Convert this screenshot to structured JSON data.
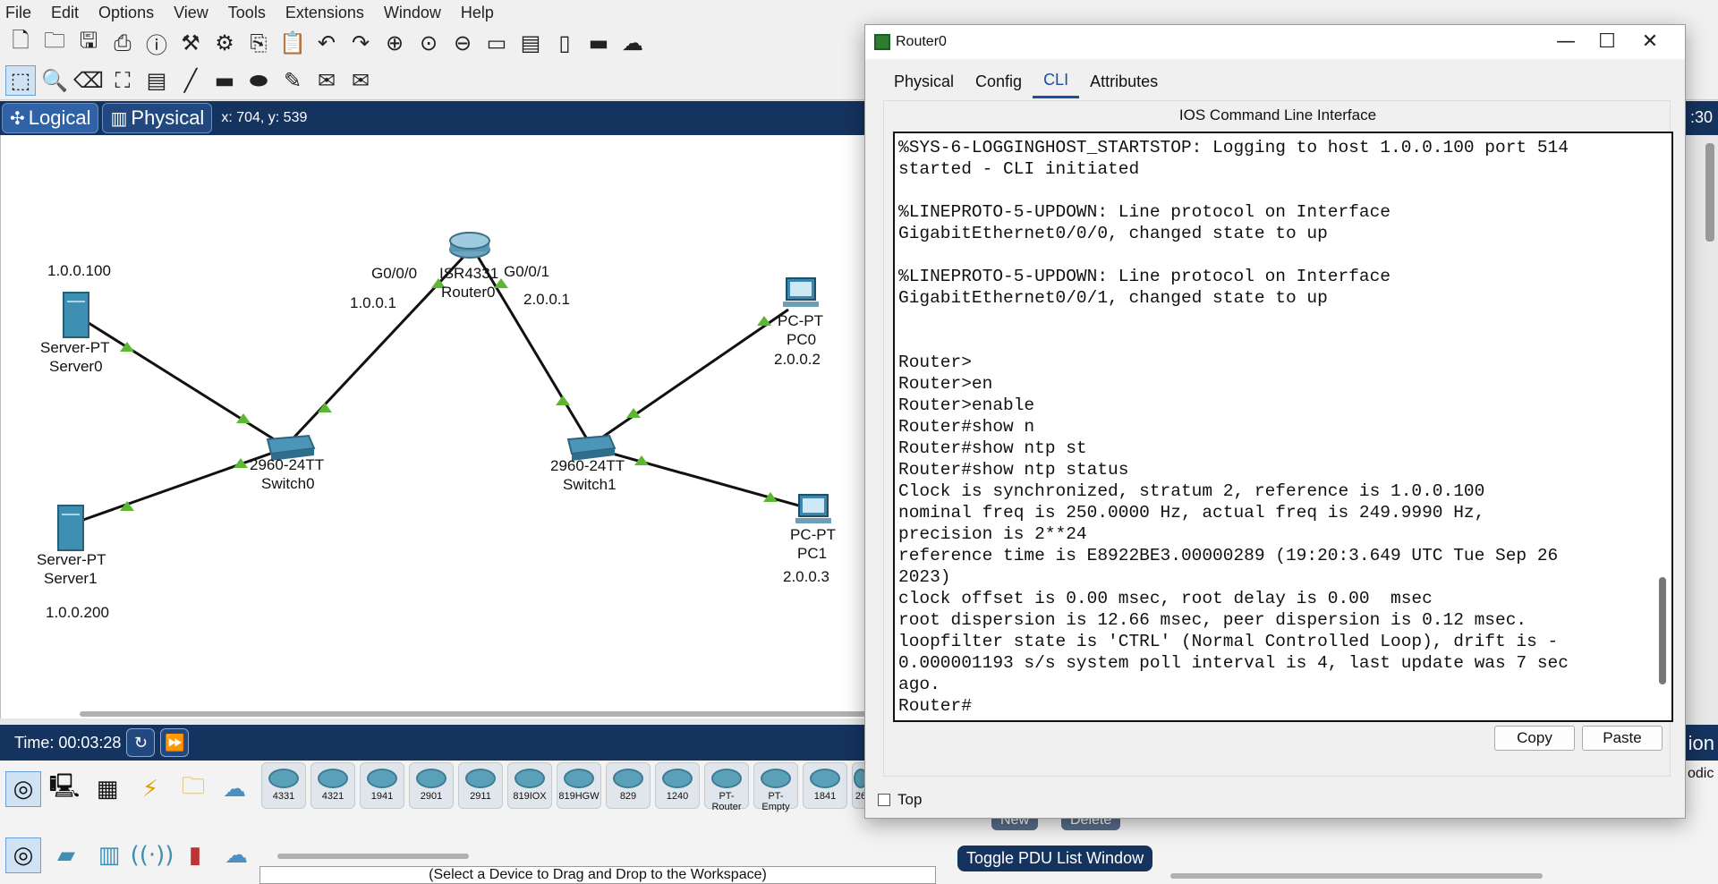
{
  "menu": [
    "File",
    "Edit",
    "Options",
    "View",
    "Tools",
    "Extensions",
    "Window",
    "Help"
  ],
  "viewbar": {
    "logical": "Logical",
    "physical": "Physical",
    "coords": "x: 704, y: 539",
    "time_fragment": ":30"
  },
  "devices": {
    "server0": {
      "model": "Server-PT",
      "name": "Server0",
      "ip": "1.0.0.100"
    },
    "server1": {
      "model": "Server-PT",
      "name": "Server1",
      "ip": "1.0.0.200"
    },
    "switch0": {
      "model": "2960-24TT",
      "name": "Switch0"
    },
    "switch1": {
      "model": "2960-24TT",
      "name": "Switch1"
    },
    "router0": {
      "model": "ISR4331",
      "name": "Router0"
    },
    "pc0": {
      "model": "PC-PT",
      "name": "PC0",
      "ip": "2.0.0.2"
    },
    "pc1": {
      "model": "PC-PT",
      "name": "PC1",
      "ip": "2.0.0.3"
    }
  },
  "ifaces": {
    "g000": "G0/0/0",
    "g001": "G0/0/1",
    "ip_left": "1.0.0.1",
    "ip_right": "2.0.0.1"
  },
  "timebar": {
    "time": "Time: 00:03:28",
    "right_fragment": "ion"
  },
  "models": [
    "4331",
    "4321",
    "1941",
    "2901",
    "2911",
    "819IOX",
    "819HGW",
    "829",
    "1240",
    "PT-Router",
    "PT-Empty",
    "1841",
    "26"
  ],
  "bottom": {
    "hint": "(Select a Device to Drag and Drop to the Workspace)",
    "pdu_toggle": "Toggle PDU List Window",
    "new": "New",
    "delete": "Delete",
    "right_fragment": "odic"
  },
  "router_window": {
    "title": "Router0",
    "tabs": [
      "Physical",
      "Config",
      "CLI",
      "Attributes"
    ],
    "active_tab": "CLI",
    "header": "IOS Command Line Interface",
    "cli_text": "%SYS-6-LOGGINGHOST_STARTSTOP: Logging to host 1.0.0.100 port 514\nstarted - CLI initiated\n\n%LINEPROTO-5-UPDOWN: Line protocol on Interface\nGigabitEthernet0/0/0, changed state to up\n\n%LINEPROTO-5-UPDOWN: Line protocol on Interface\nGigabitEthernet0/0/1, changed state to up\n\n\nRouter>\nRouter>en\nRouter>enable\nRouter#show n\nRouter#show ntp st\nRouter#show ntp status\nClock is synchronized, stratum 2, reference is 1.0.0.100\nnominal freq is 250.0000 Hz, actual freq is 249.9990 Hz,\nprecision is 2**24\nreference time is E8922BE3.00000289 (19:20:3.649 UTC Tue Sep 26\n2023)\nclock offset is 0.00 msec, root delay is 0.00  msec\nroot dispersion is 12.66 msec, peer dispersion is 0.12 msec.\nloopfilter state is 'CTRL' (Normal Controlled Loop), drift is -\n0.000001193 s/s system poll interval is 4, last update was 7 sec\nago.\nRouter#",
    "copy": "Copy",
    "paste": "Paste",
    "top_checkbox": "Top"
  }
}
